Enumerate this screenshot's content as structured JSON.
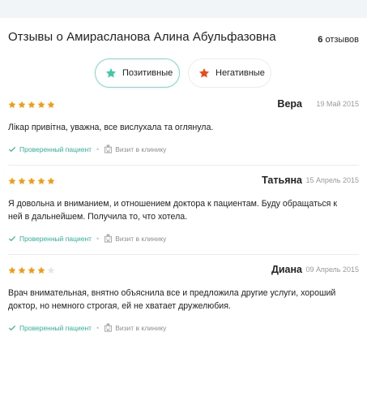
{
  "header": {
    "title": "Отзывы о Амирасланова Алина Абульфазовна",
    "count_number": "6",
    "count_label": "отзывов"
  },
  "filters": {
    "positive_label": "Позитивные",
    "negative_label": "Негативные"
  },
  "colors": {
    "star_filled": "#f59b12",
    "star_empty": "#e6e6e6",
    "positive_accent": "#3ec9a7",
    "negative_accent": "#f04a1b",
    "verified_green": "#2bb597"
  },
  "icons": {
    "positive": "star-icon",
    "negative": "star-icon",
    "verified": "check-icon",
    "visit": "hospital-icon"
  },
  "reviews": [
    {
      "rating": 5,
      "name": "Вера",
      "date": "19 Май 2015",
      "text": "Лікар привітна, уважна, все вислухала та оглянула.",
      "verified": "Проверенный пациент",
      "visit": "Визит в клинику"
    },
    {
      "rating": 5,
      "name": "Татьяна",
      "date": "15 Апрель 2015",
      "text": "Я довольна и вниманием, и отношением доктора к пациентам. Буду обращаться к ней в дальнейшем. Получила то, что хотела.",
      "verified": "Проверенный пациент",
      "visit": "Визит в клинику"
    },
    {
      "rating": 4,
      "name": "Диана",
      "date": "09 Апрель 2015",
      "text": "Врач внимательная, внятно объяснила все и предложила другие услуги, хороший доктор, но немного строгая, ей не хватает дружелюбия.",
      "verified": "Проверенный пациент",
      "visit": "Визит в клинику"
    }
  ]
}
